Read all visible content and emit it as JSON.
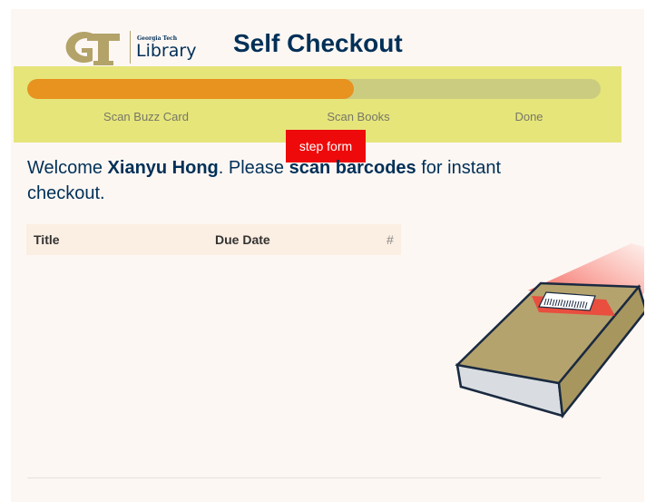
{
  "header": {
    "logo_small_text": "Georgia Tech",
    "logo_library_text": "Library",
    "title": "Self Checkout"
  },
  "stepper": {
    "progress_fraction": 0.57,
    "steps": [
      {
        "label": "Scan Buzz Card"
      },
      {
        "label": "Scan Books"
      },
      {
        "label": "Done"
      }
    ]
  },
  "overlay_tag": "step form",
  "welcome": {
    "prefix": "Welcome ",
    "user_name": "Xianyu Hong",
    "middle": ". Please ",
    "action": "scan barcodes",
    "suffix": " for instant checkout."
  },
  "table": {
    "columns": [
      "Title",
      "Due Date",
      "#"
    ]
  },
  "colors": {
    "navy": "#003057",
    "gold": "#b3a369",
    "progress": "#e8921f",
    "stepper_bg": "#e6e57a",
    "tag_red": "#ee0a0a"
  }
}
